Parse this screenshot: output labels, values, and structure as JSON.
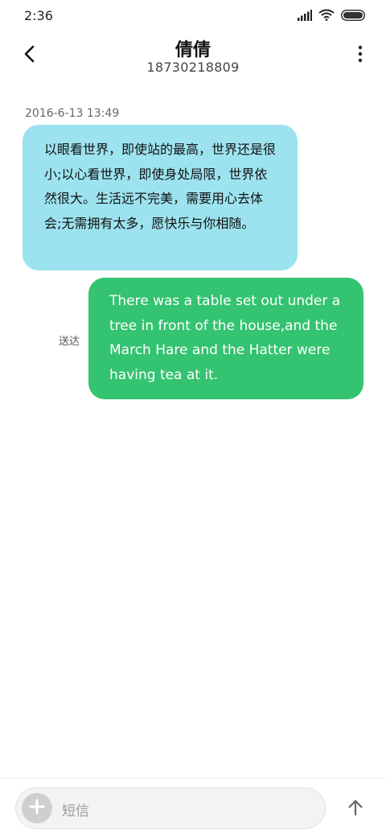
{
  "status_bar": {
    "time": "2:36",
    "icons": [
      "signal-icon",
      "wifi-icon",
      "battery-icon"
    ]
  },
  "header": {
    "contact_name": "倩倩",
    "contact_number": "18730218809",
    "back_icon": "chevron-left-icon",
    "more_icon": "more-vertical-icon"
  },
  "conversation": {
    "timestamp": "2016-6-13 13:49",
    "incoming_message": "以眼看世界，即使站的最高，世界还是很小;以心看世界，即使身处局限，世界依然很大。生活远不完美，需要用心去体会;无需拥有太多，愿快乐与你相随。",
    "outgoing_message": "There was a table set out under a tree in front of the house,and the March Hare and the Hatter were having tea at it.",
    "outgoing_status": "送达"
  },
  "input_bar": {
    "placeholder": "短信",
    "add_icon": "plus-icon",
    "send_icon": "arrow-up-icon"
  },
  "colors": {
    "incoming_bubble": "#9de3ef",
    "outgoing_bubble": "#34c370",
    "input_background": "#f3f3f3"
  }
}
